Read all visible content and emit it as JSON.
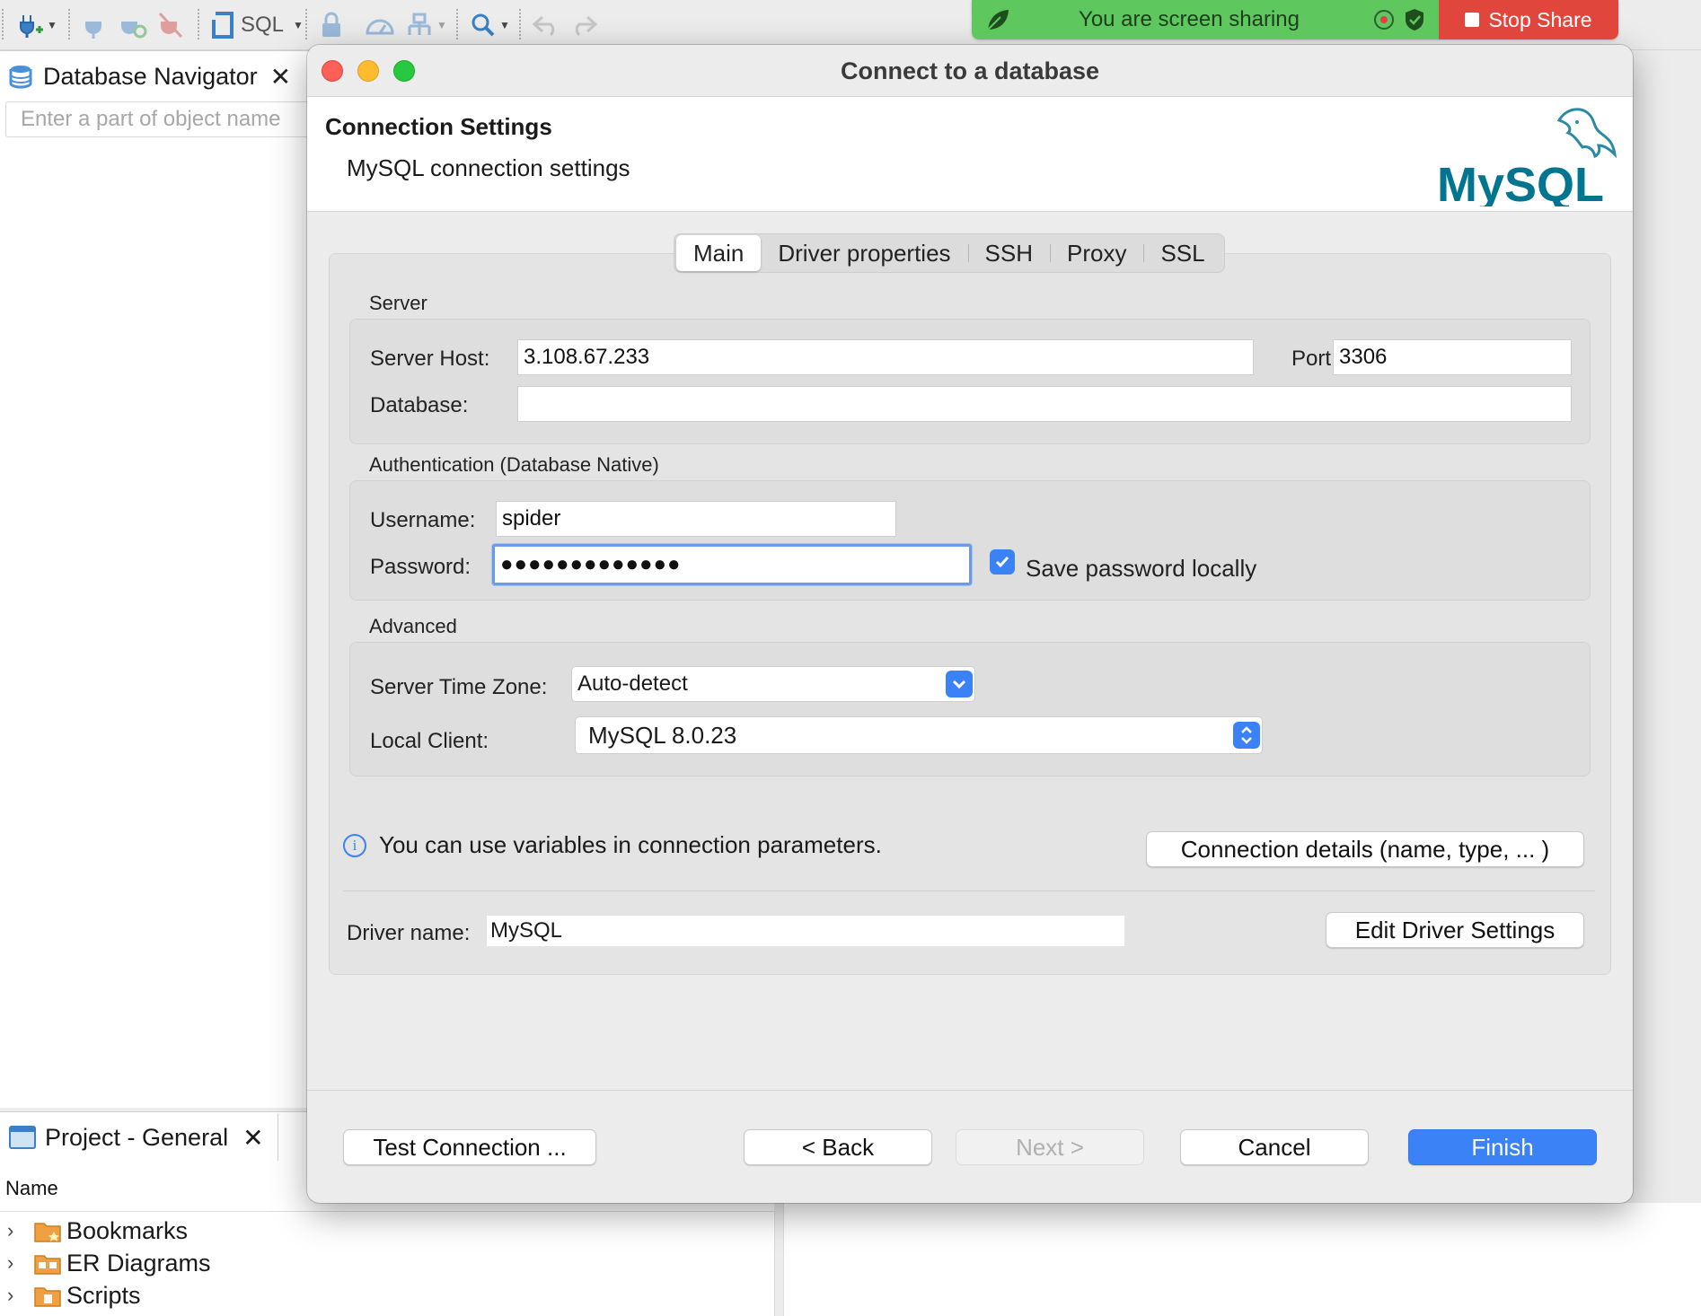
{
  "toolbar": {
    "sql_label": "SQL",
    "icons": [
      "new-connection-icon",
      "connect-icon",
      "reconnect-icon",
      "disconnect-icon",
      "sql-editor-icon",
      "lock-icon",
      "dashboard-icon",
      "commit-icon",
      "search-icon",
      "back-icon",
      "forward-icon"
    ]
  },
  "screen_share": {
    "message": "You are screen sharing",
    "stop_label": "Stop Share",
    "green": "#5ec85e",
    "red": "#e0463c"
  },
  "navigator": {
    "title": "Database Navigator",
    "filter_placeholder": "Enter a part of object name"
  },
  "project": {
    "title": "Project - General",
    "column_name": "Name",
    "items": [
      {
        "label": "Bookmarks",
        "icon": "bookmarks-folder-icon"
      },
      {
        "label": "ER Diagrams",
        "icon": "er-diagrams-folder-icon"
      },
      {
        "label": "Scripts",
        "icon": "scripts-folder-icon"
      }
    ]
  },
  "dialog": {
    "title": "Connect to a database",
    "header_title": "Connection Settings",
    "header_subtitle": "MySQL connection settings",
    "logo_text": "MySQL",
    "tabs": [
      "Main",
      "Driver properties",
      "SSH",
      "Proxy",
      "SSL"
    ],
    "active_tab": "Main",
    "server": {
      "group_label": "Server",
      "host_label": "Server Host:",
      "host_value": "3.108.67.233",
      "port_label": "Port:",
      "port_value": "3306",
      "database_label": "Database:",
      "database_value": ""
    },
    "auth": {
      "group_label": "Authentication (Database Native)",
      "username_label": "Username:",
      "username_value": "spider",
      "password_label": "Password:",
      "password_value": "●●●●●●●●●●●●●",
      "save_password_label": "Save password locally",
      "save_password_checked": true
    },
    "advanced": {
      "group_label": "Advanced",
      "timezone_label": "Server Time Zone:",
      "timezone_value": "Auto-detect",
      "local_client_label": "Local Client:",
      "local_client_value": "MySQL 8.0.23"
    },
    "info_text": "You can use variables in connection parameters.",
    "connection_details_label": "Connection details (name, type, ... )",
    "driver_name_label": "Driver name:",
    "driver_name_value": "MySQL",
    "edit_driver_label": "Edit Driver Settings",
    "buttons": {
      "test": "Test Connection ...",
      "back": "< Back",
      "next": "Next >",
      "cancel": "Cancel",
      "finish": "Finish"
    },
    "accent": "#3b82f6"
  }
}
